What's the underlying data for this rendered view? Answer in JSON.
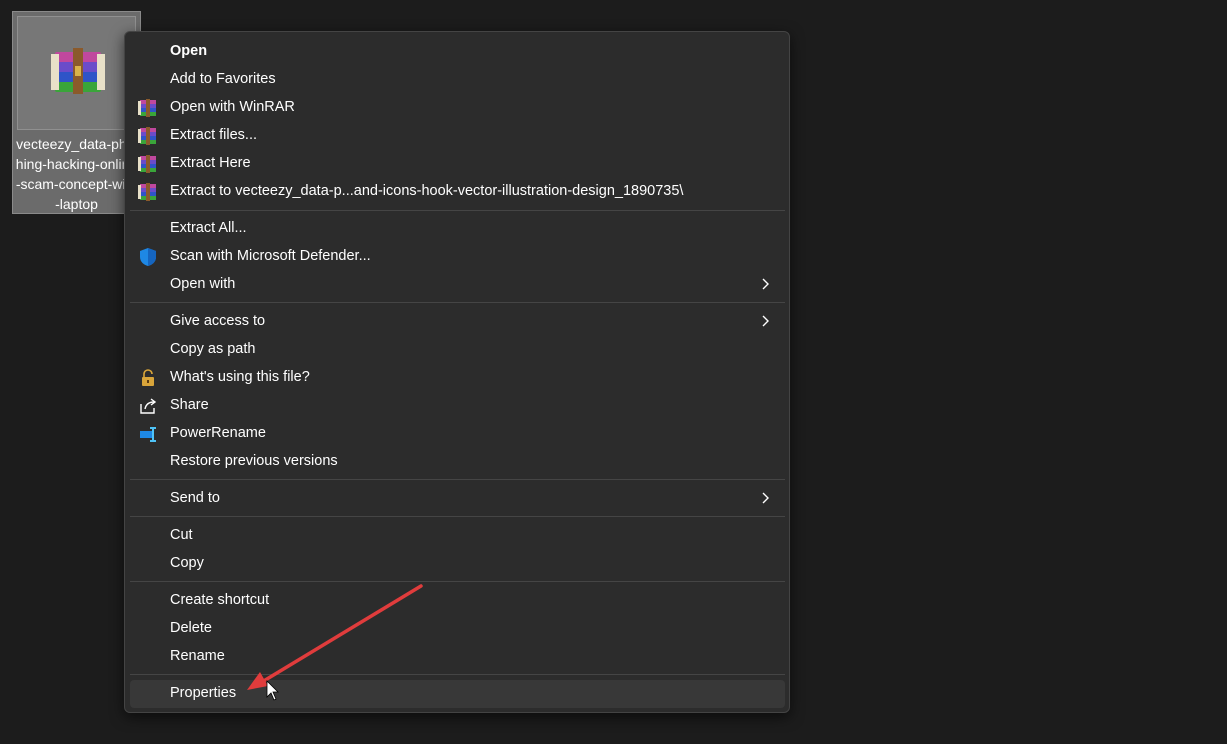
{
  "desktop": {
    "file": {
      "name": "vecteezy_data-phishing-hacking-online-scam-concept-with-laptop",
      "icon": "winrar-archive-icon"
    }
  },
  "menu": {
    "group1": [
      {
        "label": "Open",
        "bold": true,
        "icon": ""
      },
      {
        "label": "Add to Favorites",
        "icon": ""
      },
      {
        "label": "Open with WinRAR",
        "icon": "winrar-icon"
      },
      {
        "label": "Extract files...",
        "icon": "winrar-icon"
      },
      {
        "label": "Extract Here",
        "icon": "winrar-icon"
      },
      {
        "label": "Extract to vecteezy_data-p...and-icons-hook-vector-illustration-design_1890735\\",
        "icon": "winrar-icon"
      }
    ],
    "group2": [
      {
        "label": "Extract All...",
        "icon": ""
      },
      {
        "label": "Scan with Microsoft Defender...",
        "icon": "defender-shield-icon"
      },
      {
        "label": "Open with",
        "icon": "",
        "submenu": true
      }
    ],
    "group3": [
      {
        "label": "Give access to",
        "icon": "",
        "submenu": true
      },
      {
        "label": "Copy as path",
        "icon": ""
      },
      {
        "label": "What's using this file?",
        "icon": "lock-icon"
      },
      {
        "label": "Share",
        "icon": "share-icon"
      },
      {
        "label": "PowerRename",
        "icon": "powerrename-icon"
      },
      {
        "label": "Restore previous versions",
        "icon": ""
      }
    ],
    "group4": [
      {
        "label": "Send to",
        "icon": "",
        "submenu": true
      }
    ],
    "group5": [
      {
        "label": "Cut",
        "icon": ""
      },
      {
        "label": "Copy",
        "icon": ""
      }
    ],
    "group6": [
      {
        "label": "Create shortcut",
        "icon": ""
      },
      {
        "label": "Delete",
        "icon": ""
      },
      {
        "label": "Rename",
        "icon": ""
      }
    ],
    "group7": [
      {
        "label": "Properties",
        "icon": "",
        "highlighted": true
      }
    ]
  },
  "colors": {
    "menu_bg": "#2c2c2c",
    "hover_bg": "#383838",
    "annotation_arrow": "#e03c3c",
    "defender_blue": "#1e88e5"
  }
}
